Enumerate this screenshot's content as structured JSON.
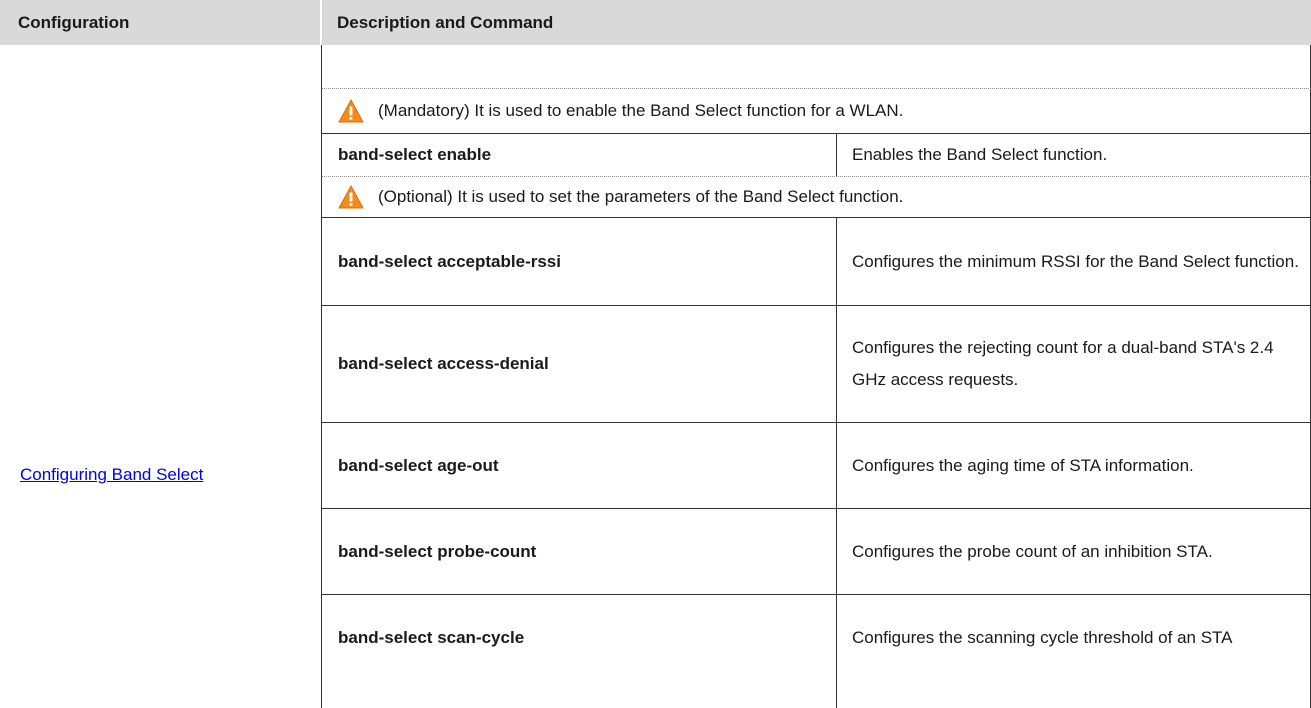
{
  "header": {
    "configuration": "Configuration",
    "description_and_command": "Description and Command"
  },
  "configuration_link": "Configuring Band Select",
  "notes": {
    "mandatory": "(Mandatory) It is used to enable the Band Select function for a WLAN.",
    "optional": "(Optional) It is used to set the parameters of the Band Select function."
  },
  "commands": [
    {
      "command": "band-select enable",
      "description": "Enables the Band Select function."
    },
    {
      "command": "band-select acceptable-rssi",
      "description": "Configures the minimum RSSI for the Band Select function."
    },
    {
      "command": "band-select access-denial",
      "description": "Configures the rejecting count for a dual-band STA's 2.4 GHz access requests."
    },
    {
      "command": "band-select age-out",
      "description": "Configures the aging time of STA information."
    },
    {
      "command": "band-select probe-count",
      "description": "Configures the probe count of an inhibition STA."
    },
    {
      "command": "band-select scan-cycle",
      "description": "Configures the scanning cycle threshold of an STA"
    }
  ],
  "colors": {
    "header_bg": "#d9d9d9",
    "link": "#0000ee",
    "warning_orange": "#f28c1e"
  },
  "icons": {
    "note_icon": "warning-triangle-icon"
  }
}
